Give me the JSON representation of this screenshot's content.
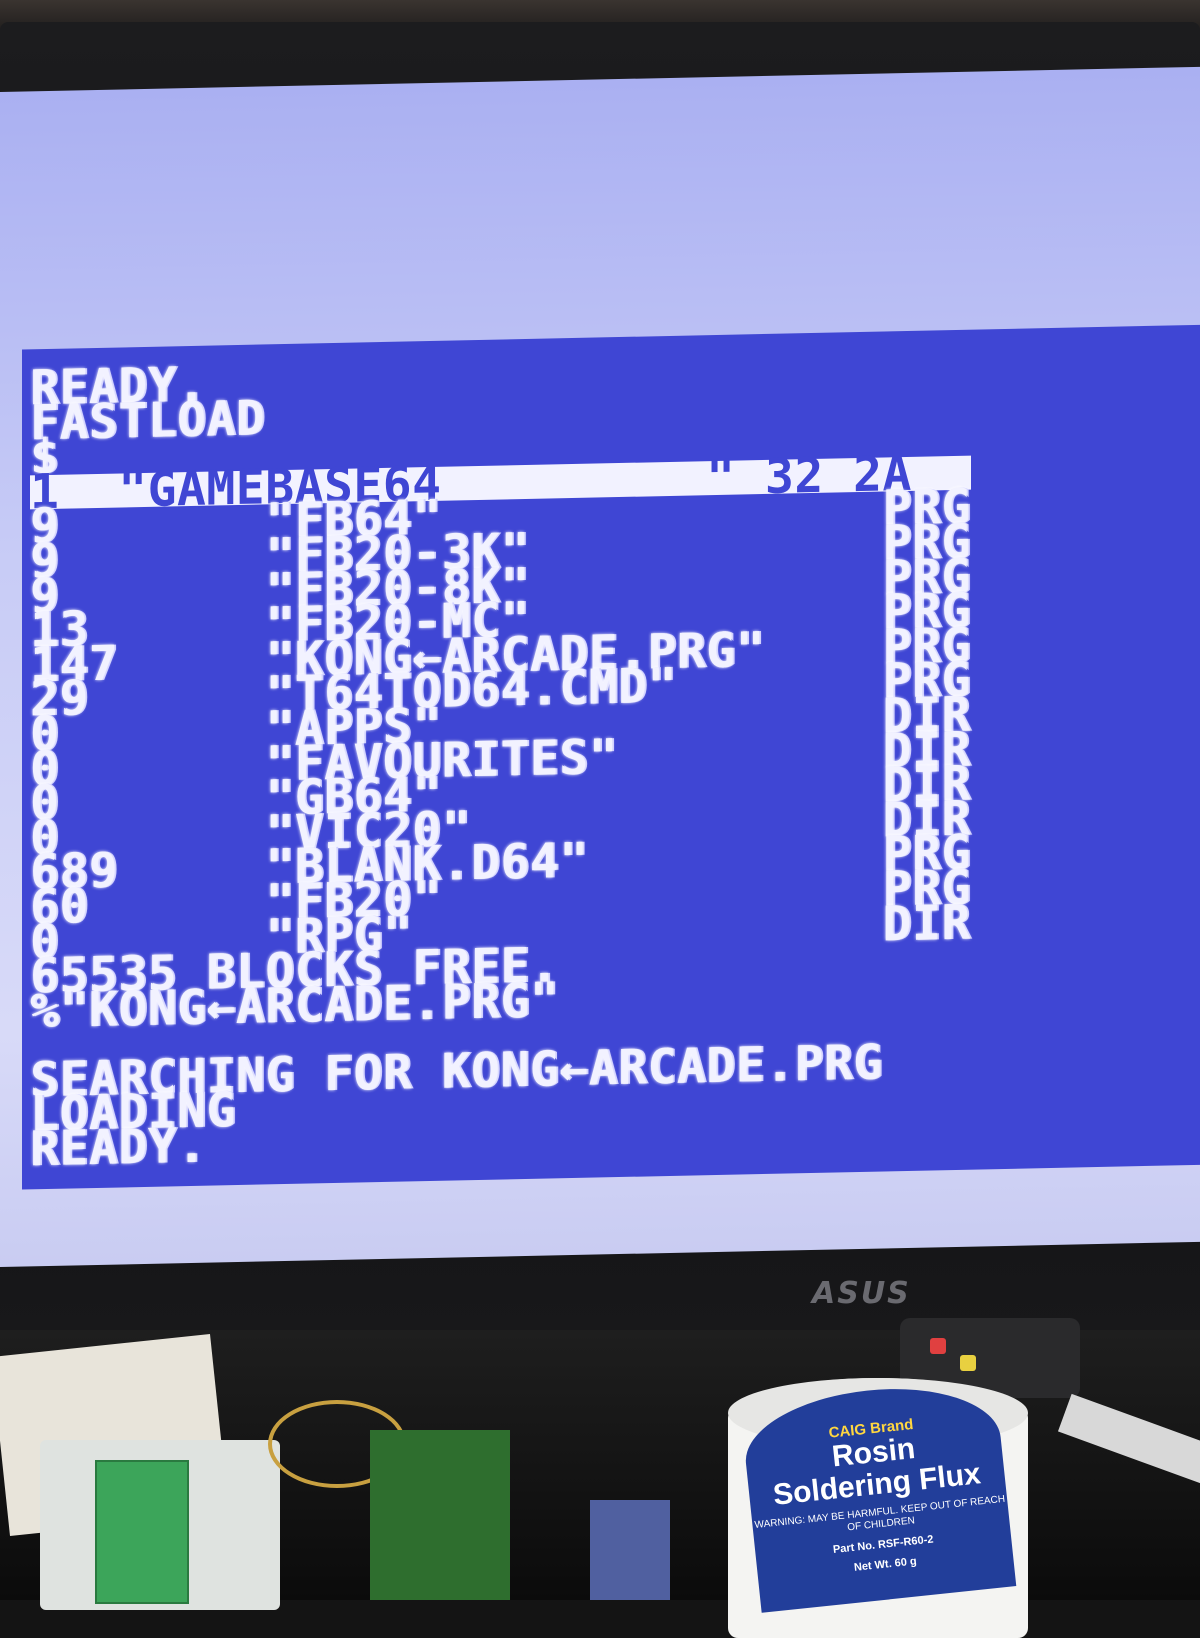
{
  "monitor": {
    "brand": "ASUS"
  },
  "terminal": {
    "lines": [
      "READY.",
      "FASTLOAD",
      "$",
      "1  \"GAMEBASE64         \" 32 2A",
      "9       \"FB64\"               PRG",
      "9       \"FB20-3K\"            PRG",
      "9       \"FB20-8K\"            PRG",
      "13      \"FB20-MC\"            PRG",
      "147     \"KONG←ARCADE.PRG\"    PRG",
      "29      \"T64TOD64.CMD\"       PRG",
      "0       \"APPS\"               DIR",
      "0       \"FAVOURITES\"         DIR",
      "0       \"GB64\"               DIR",
      "0       \"VIC20\"              DIR",
      "689     \"BLANK.D64\"          PRG",
      "60      \"FB20\"               PRG",
      "0       \"RPG\"                DIR",
      "65535 BLOCKS FREE.",
      "%\"KONG←ARCADE.PRG\"",
      "",
      "SEARCHING FOR KONG←ARCADE.PRG",
      "LOADING",
      "READY."
    ]
  },
  "jar": {
    "brand": "CAIG Brand",
    "product_line1": "Rosin",
    "product_line2": "Soldering Flux",
    "warning": "WARNING: MAY BE HARMFUL. KEEP OUT OF REACH OF CHILDREN",
    "part_no": "Part No. RSF-R60-2",
    "net_wt": "Net Wt. 60 g"
  },
  "colors": {
    "c64_background": "#3f46d4",
    "c64_border": "#aab0f2",
    "c64_text": "#f2f2ff"
  }
}
